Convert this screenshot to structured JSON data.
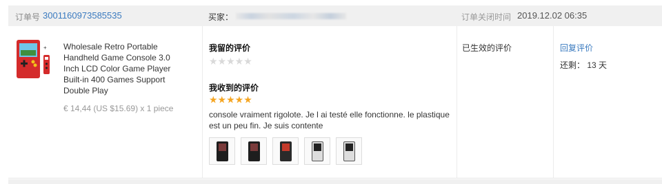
{
  "header": {
    "order_label": "订单号",
    "order_number": "3001160973585535",
    "buyer_label": "买家：",
    "closed_label": "订单关闭时间",
    "closed_time": "2019.12.02 06:35"
  },
  "product": {
    "title": "Wholesale Retro Portable Handheld Game Console 3.0 Inch LCD Color Game Player Built-in 400 Games Support Double Play",
    "price_line": "€ 14,44 (US $15.69) x 1 piece",
    "thumb_icon": "game-console-icon"
  },
  "reviews": {
    "my_review_label": "我留的评价",
    "my_review_stars": "★★★★★",
    "my_review_rating": 0,
    "received_label": "我收到的评价",
    "received_stars": "★★★★★",
    "received_rating": 5,
    "received_text": "console vraiment rigolote. Je l ai testé elle fonctionne. le plastique est un peu fin. Je suis contente",
    "photo_count": 5
  },
  "status": {
    "text": "已生效的评价"
  },
  "actions": {
    "reply_label": "回复评价",
    "remaining_text": "还剩： 13 天"
  },
  "colors": {
    "link": "#3a7abf",
    "star": "#f5a623",
    "star_empty": "#d9d9d9",
    "header_bg": "#f0f0f0"
  }
}
